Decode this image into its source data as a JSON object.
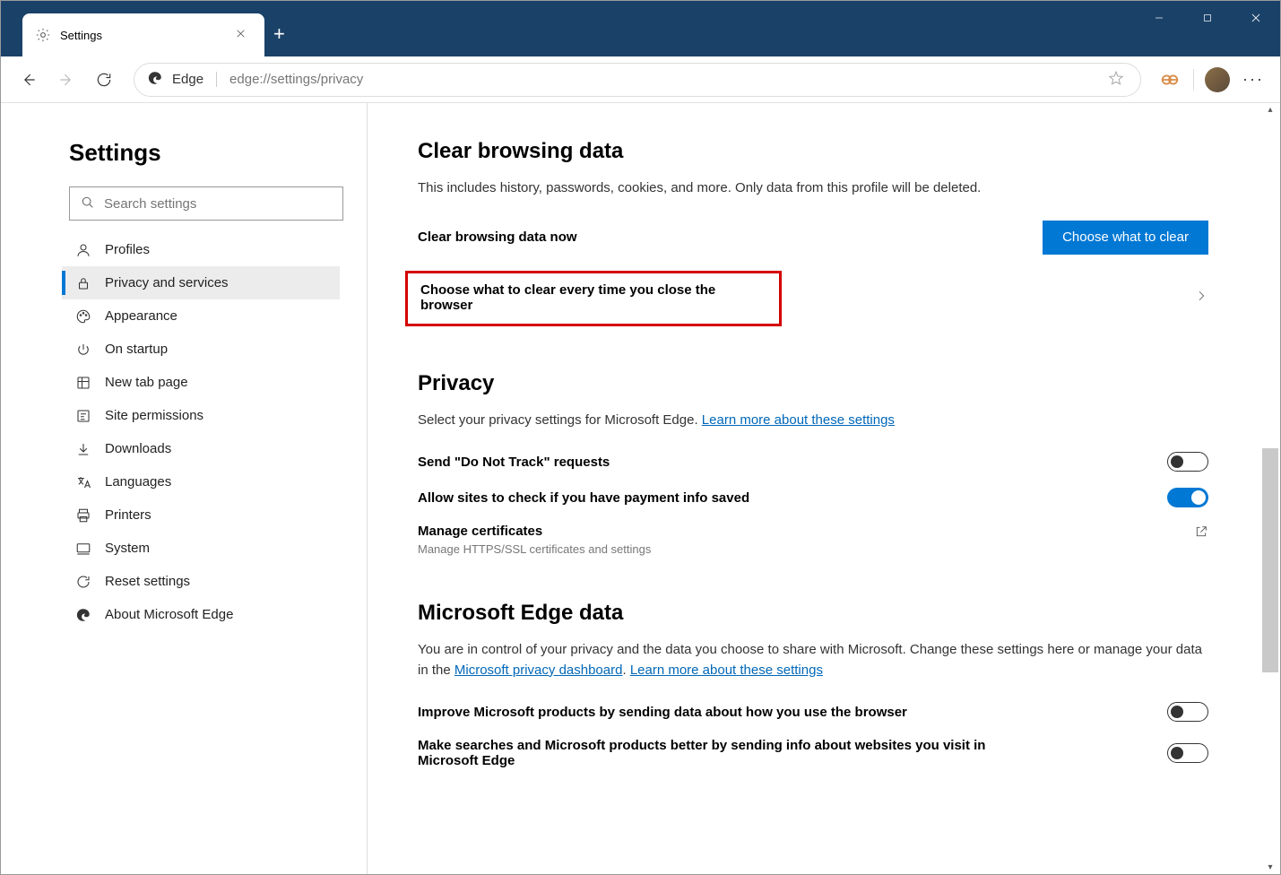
{
  "tab": {
    "title": "Settings"
  },
  "address": {
    "brand": "Edge",
    "url": "edge://settings/privacy"
  },
  "sidebar": {
    "heading": "Settings",
    "search_placeholder": "Search settings",
    "items": [
      {
        "label": "Profiles"
      },
      {
        "label": "Privacy and services"
      },
      {
        "label": "Appearance"
      },
      {
        "label": "On startup"
      },
      {
        "label": "New tab page"
      },
      {
        "label": "Site permissions"
      },
      {
        "label": "Downloads"
      },
      {
        "label": "Languages"
      },
      {
        "label": "Printers"
      },
      {
        "label": "System"
      },
      {
        "label": "Reset settings"
      },
      {
        "label": "About Microsoft Edge"
      }
    ]
  },
  "main": {
    "section1": {
      "heading": "Clear browsing data",
      "desc": "This includes history, passwords, cookies, and more. Only data from this profile will be deleted.",
      "row1_label": "Clear browsing data now",
      "row1_button": "Choose what to clear",
      "row2_label": "Choose what to clear every time you close the browser"
    },
    "section2": {
      "heading": "Privacy",
      "desc_prefix": "Select your privacy settings for Microsoft Edge. ",
      "desc_link": "Learn more about these settings",
      "toggle1_label": "Send \"Do Not Track\" requests",
      "toggle2_label": "Allow sites to check if you have payment info saved",
      "certs_label": "Manage certificates",
      "certs_sub": "Manage HTTPS/SSL certificates and settings"
    },
    "section3": {
      "heading": "Microsoft Edge data",
      "desc_prefix": "You are in control of your privacy and the data you choose to share with Microsoft. Change these settings here or manage your data in the ",
      "desc_link1": "Microsoft privacy dashboard",
      "desc_sep": ". ",
      "desc_link2": "Learn more about these settings",
      "toggle1_label": "Improve Microsoft products by sending data about how you use the browser",
      "toggle2_label": "Make searches and Microsoft products better by sending info about websites you visit in Microsoft Edge"
    }
  }
}
